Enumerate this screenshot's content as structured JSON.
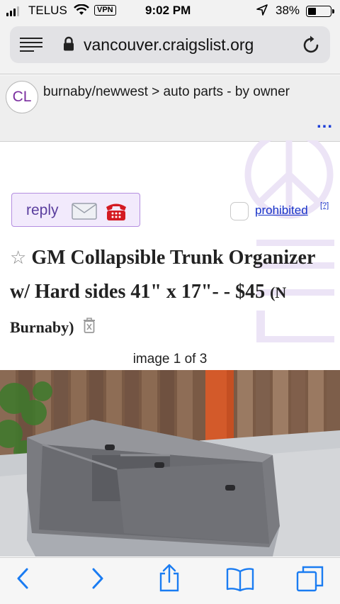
{
  "status_bar": {
    "carrier": "TELUS",
    "vpn": "VPN",
    "time": "9:02 PM",
    "battery": "38%",
    "battery_level": 0.38
  },
  "browser": {
    "url": "vancouver.craigslist.org"
  },
  "header": {
    "logo": "CL",
    "breadcrumb_area": "burnaby/newwest",
    "breadcrumb_sep": " > ",
    "breadcrumb_category": "auto parts - by owner",
    "more": "..."
  },
  "posting": {
    "reply_label": "reply",
    "prohibited_label": "prohibited",
    "prohibited_help": "[?]",
    "star": "☆",
    "title": "GM Collapsible Trunk Organizer w/ Hard sides 41\" x 17\"- - $45",
    "location": "(N Burnaby)",
    "image_counter": "image 1 of 3"
  },
  "icons": {
    "menu": "menu-icon",
    "lock": "lock-icon",
    "reload": "reload-icon",
    "mail": "mail-icon",
    "phone": "phone-icon",
    "trash": "trash-icon",
    "back": "chevron-left-icon",
    "forward": "chevron-right-icon",
    "share": "share-icon",
    "bookmarks": "book-icon",
    "tabs": "tabs-icon"
  },
  "colors": {
    "link": "#1732c8",
    "reply_bg": "#f2eafc",
    "reply_border": "#b48ee0",
    "cl_purple": "#7b2fa0",
    "ios_blue": "#1a7cf2"
  }
}
